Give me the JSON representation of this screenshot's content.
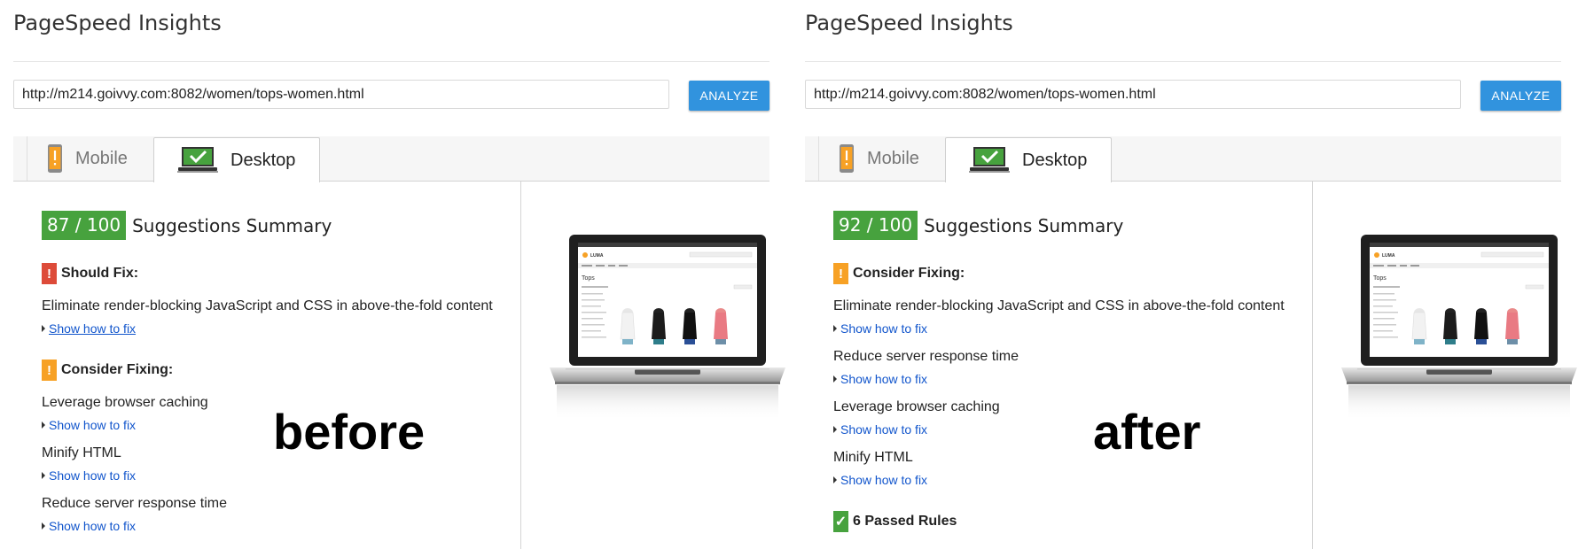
{
  "panels": [
    {
      "app_title": "PageSpeed Insights",
      "url_value": "http://m214.goivvy.com:8082/women/tops-women.html",
      "analyze_label": "ANALYZE",
      "tabs": {
        "mobile": "Mobile",
        "desktop": "Desktop"
      },
      "score": "87 / 100",
      "summary_label": "Suggestions Summary",
      "should_fix_title": "Should Fix:",
      "should_fix_items": [
        "Eliminate render-blocking JavaScript and CSS in above-the-fold content"
      ],
      "consider_title": "Consider Fixing:",
      "consider_items": [
        "Leverage browser caching",
        "Minify HTML",
        "Reduce server response time"
      ],
      "show_fix_label": "Show how to fix",
      "overlay_word": "before"
    },
    {
      "app_title": "PageSpeed Insights",
      "url_value": "http://m214.goivvy.com:8082/women/tops-women.html",
      "analyze_label": "ANALYZE",
      "tabs": {
        "mobile": "Mobile",
        "desktop": "Desktop"
      },
      "score": "92 / 100",
      "summary_label": "Suggestions Summary",
      "consider_title": "Consider Fixing:",
      "consider_items": [
        "Eliminate render-blocking JavaScript and CSS in above-the-fold content",
        "Reduce server response time",
        "Leverage browser caching",
        "Minify HTML"
      ],
      "show_fix_label": "Show how to fix",
      "passed_label": "6 Passed Rules",
      "overlay_word": "after"
    }
  ],
  "icons": {
    "mobile_tab": "phone-warning-icon",
    "desktop_tab": "laptop-check-icon",
    "should_fix": "exclamation-icon",
    "consider": "exclamation-icon",
    "passed": "checkmark-icon",
    "caret": "caret-right-icon"
  },
  "colors": {
    "score_green": "#47a23e",
    "should_fix_red": "#dd4b39",
    "consider_orange": "#f7a125",
    "analyze_blue": "#3193de",
    "link_blue": "#1155cc"
  },
  "screenshot_thumbnail": {
    "brand": "LUMA",
    "heading": "Tops"
  }
}
